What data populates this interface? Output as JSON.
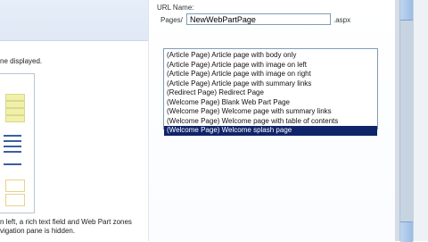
{
  "left": {
    "description_top": "ne displayed.",
    "description_bottom_lines": [
      "n left, a rich text field and Web Part zones",
      "vigation pane is hidden."
    ]
  },
  "form": {
    "url_label": "URL Name:",
    "pages_prefix": "Pages/",
    "url_value": "NewWebPartPage",
    "aspx_suffix": ".aspx"
  },
  "layouts": {
    "items": [
      "(Article Page) Article page with body only",
      "(Article Page) Article page with image on left",
      "(Article Page) Article page with image on right",
      "(Article Page) Article page with summary links",
      "(Redirect Page) Redirect Page",
      "(Welcome Page) Blank Web Part Page",
      "(Welcome Page) Welcome page with summary links",
      "(Welcome Page) Welcome page with table of contents",
      "(Welcome Page) Welcome splash page"
    ],
    "selected_index": 8
  }
}
